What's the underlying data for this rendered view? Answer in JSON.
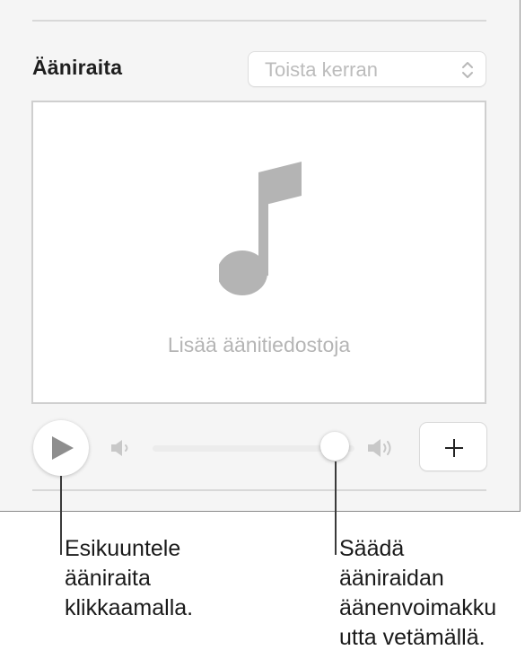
{
  "soundtrack": {
    "title": "Ääniraita",
    "playback_mode": "Toista kerran",
    "dropzone_label": "Lisää äänitiedostoja",
    "volume_level": 0.9
  },
  "icons": {
    "note": "music-note-icon",
    "play": "play-icon",
    "volume_low": "speaker-low-icon",
    "volume_high": "speaker-high-icon",
    "add": "plus-icon"
  },
  "callouts": {
    "play_lines": [
      "Esikuuntele",
      "ääniraita",
      "klikkaamalla."
    ],
    "volume_lines": [
      "Säädä",
      "ääniraidan",
      "äänenvoimakku",
      "utta vetämällä."
    ]
  }
}
